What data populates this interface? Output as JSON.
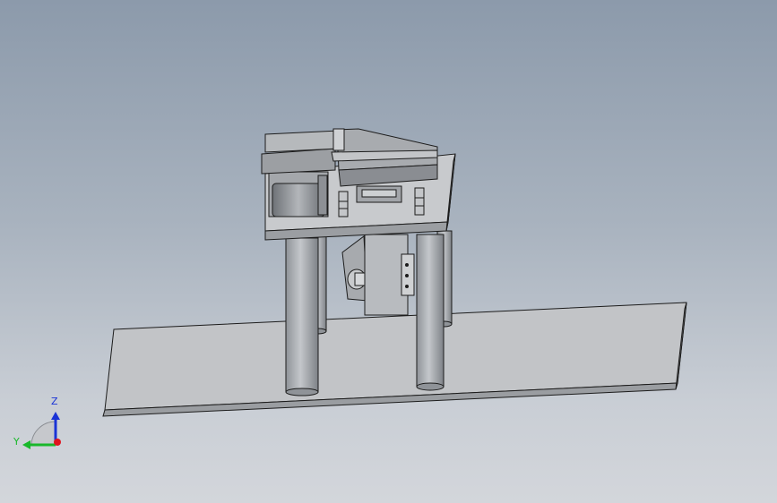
{
  "viewport": {
    "background_top": "#8c9aab",
    "background_bottom": "#d3d6db"
  },
  "triad": {
    "z_label": "Z",
    "y_label": "Y",
    "z_color": "#1a33d6",
    "y_color": "#19b82b",
    "x_color": "#e0141e"
  },
  "model": {
    "part_color": "#b9bcc0",
    "edge_color": "#1c1c1c"
  }
}
